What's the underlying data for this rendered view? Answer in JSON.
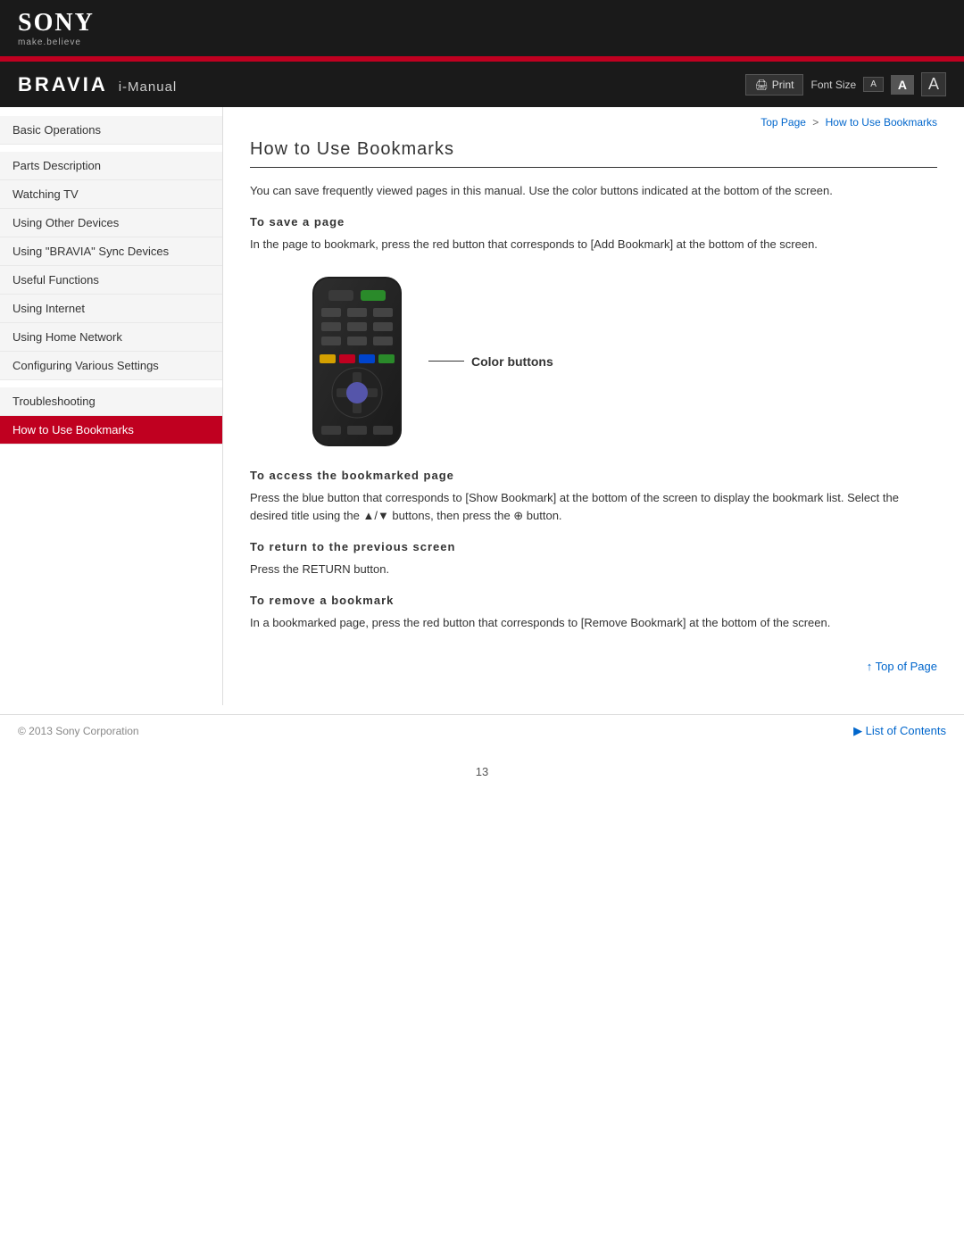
{
  "header": {
    "sony_logo": "SONY",
    "sony_tagline": "make.believe",
    "bravia": "BRAVIA",
    "imanual": "i-Manual",
    "print_label": "Print",
    "font_size_label": "Font Size",
    "font_small": "A",
    "font_medium": "A",
    "font_large": "A"
  },
  "breadcrumb": {
    "top_page": "Top Page",
    "separator": ">",
    "current": "How to Use Bookmarks"
  },
  "sidebar": {
    "items": [
      {
        "id": "basic-operations",
        "label": "Basic Operations",
        "active": false
      },
      {
        "id": "parts-description",
        "label": "Parts Description",
        "active": false
      },
      {
        "id": "watching-tv",
        "label": "Watching TV",
        "active": false
      },
      {
        "id": "using-other-devices",
        "label": "Using Other Devices",
        "active": false
      },
      {
        "id": "using-bravia-sync",
        "label": "Using \"BRAVIA\" Sync Devices",
        "active": false
      },
      {
        "id": "useful-functions",
        "label": "Useful Functions",
        "active": false
      },
      {
        "id": "using-internet",
        "label": "Using Internet",
        "active": false
      },
      {
        "id": "using-home-network",
        "label": "Using Home Network",
        "active": false
      },
      {
        "id": "configuring-various",
        "label": "Configuring Various Settings",
        "active": false
      },
      {
        "id": "troubleshooting",
        "label": "Troubleshooting",
        "active": false
      },
      {
        "id": "how-to-use-bookmarks",
        "label": "How to Use Bookmarks",
        "active": true
      }
    ]
  },
  "content": {
    "page_title": "How to Use Bookmarks",
    "intro_text": "You can save frequently viewed pages in this manual. Use the color buttons indicated at the bottom of the screen.",
    "save_subtitle": "To save a page",
    "save_text": "In the page to bookmark, press the red button that corresponds to [Add Bookmark] at the bottom of the screen.",
    "color_buttons_label": "Color buttons",
    "access_subtitle": "To access the bookmarked page",
    "access_text": "Press the blue button that corresponds to [Show Bookmark] at the bottom of the screen to display the bookmark list. Select the desired title using the ▲/▼ buttons, then press the ⊕ button.",
    "return_subtitle": "To return to the previous screen",
    "return_text": "Press the RETURN button.",
    "remove_subtitle": "To remove a bookmark",
    "remove_text": "In a bookmarked page, press the red button that corresponds to [Remove Bookmark] at the bottom of the screen.",
    "top_of_page": "Top of Page",
    "list_of_contents": "List of Contents"
  },
  "footer": {
    "copyright": "© 2013 Sony Corporation",
    "page_number": "13"
  }
}
